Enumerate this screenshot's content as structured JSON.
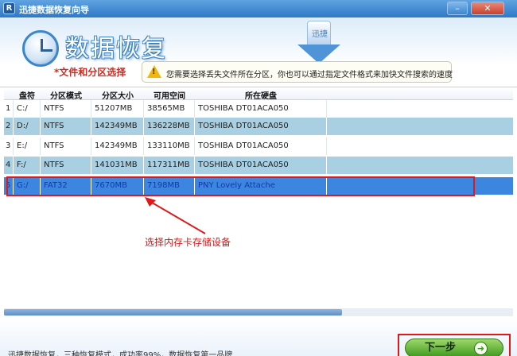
{
  "window": {
    "logo": "R",
    "title": "迅捷数据恢复向导",
    "minimize_glyph": "–",
    "close_glyph": "✕"
  },
  "header": {
    "brand_title": "数据恢复",
    "step_label": "*文件和分区选择",
    "arrow_text": "迅捷",
    "hint": "您需要选择丢失文件所在分区，你也可以通过指定文件格式来加快文件搜索的速度"
  },
  "table": {
    "columns": [
      "盘符",
      "分区模式",
      "分区大小",
      "可用空间",
      "所在硬盘"
    ],
    "rows": [
      {
        "index": "1",
        "drive": "C:/",
        "fs": "NTFS",
        "size": "51207MB",
        "free": "38565MB",
        "disk": "TOSHIBA DT01ACA050"
      },
      {
        "index": "2",
        "drive": "D:/",
        "fs": "NTFS",
        "size": "142349MB",
        "free": "136228MB",
        "disk": "TOSHIBA DT01ACA050"
      },
      {
        "index": "3",
        "drive": "E:/",
        "fs": "NTFS",
        "size": "142349MB",
        "free": "133110MB",
        "disk": "TOSHIBA DT01ACA050"
      },
      {
        "index": "4",
        "drive": "F:/",
        "fs": "NTFS",
        "size": "141031MB",
        "free": "117311MB",
        "disk": "TOSHIBA DT01ACA050"
      },
      {
        "index": "5",
        "drive": "G:/",
        "fs": "FAT32",
        "size": "7670MB",
        "free": "7198MB",
        "disk": "PNY Lovely Attache"
      }
    ],
    "selected_index": 4
  },
  "annotation": {
    "callout": "选择内存卡存储设备"
  },
  "footer": {
    "text": "迅捷数据恢复，三种恢复模式，成功率99%，数据恢复第一品牌",
    "next_label": "下一步",
    "next_icon_glyph": "➜"
  },
  "colors": {
    "accent": "#3c86e0",
    "alt_row": "#a8cfe2",
    "annotation_red": "#e01818",
    "next_green": "#3f9a1f"
  }
}
